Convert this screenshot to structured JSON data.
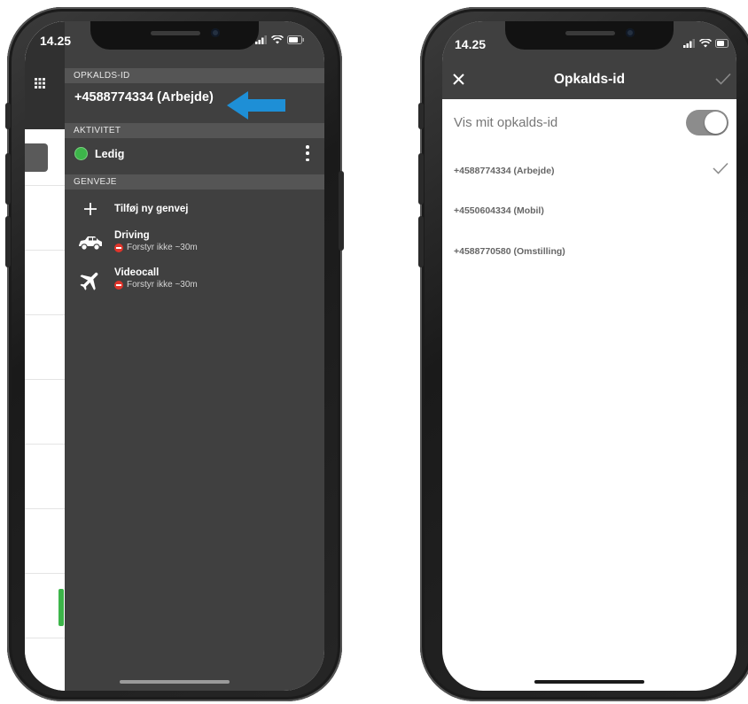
{
  "left_phone": {
    "status_time": "14.25",
    "sections": {
      "caller_id_header": "OPKALDS-ID",
      "activity_header": "AKTIVITET",
      "shortcuts_header": "GENVEJE"
    },
    "caller_id": "+4588774334 (Arbejde)",
    "activity": {
      "status": "Ledig",
      "status_color": "#3db54a"
    },
    "add_shortcut_label": "Tilføj ny genvej",
    "shortcuts": [
      {
        "title": "Driving",
        "subtitle": "Forstyr ikke ~30m",
        "icon": "car-icon"
      },
      {
        "title": "Videocall",
        "subtitle": "Forstyr ikke ~30m",
        "icon": "airplane-icon"
      }
    ],
    "arrow_color": "#1e8fd6"
  },
  "right_phone": {
    "status_time": "14.25",
    "header_title": "Opkalds-id",
    "toggle": {
      "label": "Vis mit opkalds-id",
      "on": true
    },
    "numbers": [
      {
        "label": "+4588774334 (Arbejde)",
        "selected": true
      },
      {
        "label": "+4550604334 (Mobil)",
        "selected": false
      },
      {
        "label": "+4588770580 (Omstilling)",
        "selected": false
      }
    ]
  },
  "colors": {
    "drawer_bg": "#404040",
    "section_header_bg": "#555555",
    "dnd_red": "#e0342a"
  }
}
